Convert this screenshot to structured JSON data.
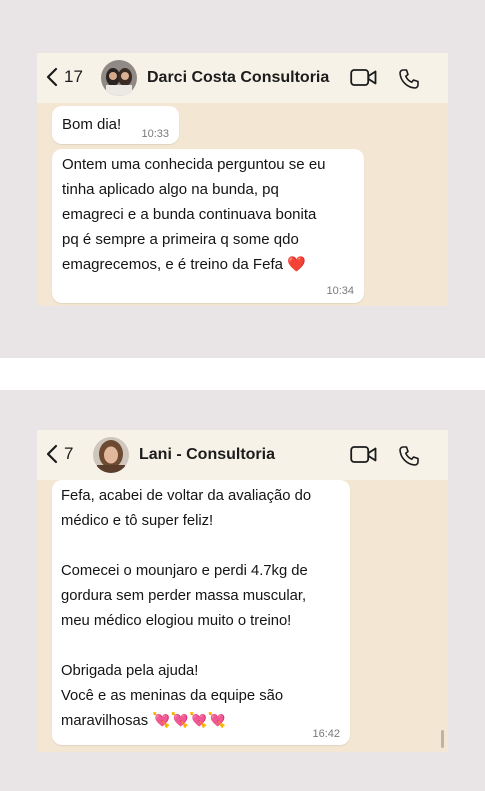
{
  "chat1": {
    "back_count": "17",
    "contact_name": "Darci Costa Consultoria",
    "messages": [
      {
        "text": "Bom dia!",
        "time": "10:33"
      },
      {
        "text": "Ontem uma conhecida perguntou se eu\ntinha aplicado algo na bunda, pq\nemagreci e a bunda continuava bonita\npq é sempre a primeira q some qdo\nemagrecemos, e é treino da Fefa ❤️",
        "time": "10:34"
      }
    ]
  },
  "chat2": {
    "back_count": "7",
    "contact_name": "Lani - Consultoria",
    "messages": [
      {
        "text": "Fefa, acabei de voltar da avaliação do\nmédico e tô super feliz!\n\nComecei o mounjaro e perdi 4.7kg de\ngordura sem perder massa muscular,\nmeu médico elogiou muito o treino!\n\nObrigada pela ajuda!\nVocê e as meninas da equipe são\nmaravilhosas 💘💘💘💘",
        "time": "16:42"
      }
    ]
  },
  "icons": [
    "chevron-left-icon",
    "video-call-icon",
    "phone-icon"
  ],
  "colors": {
    "chat_background": "#f3e6d2",
    "header": "#f6f2e8",
    "bubble": "#ffffff",
    "page": "#e9e4e6"
  }
}
